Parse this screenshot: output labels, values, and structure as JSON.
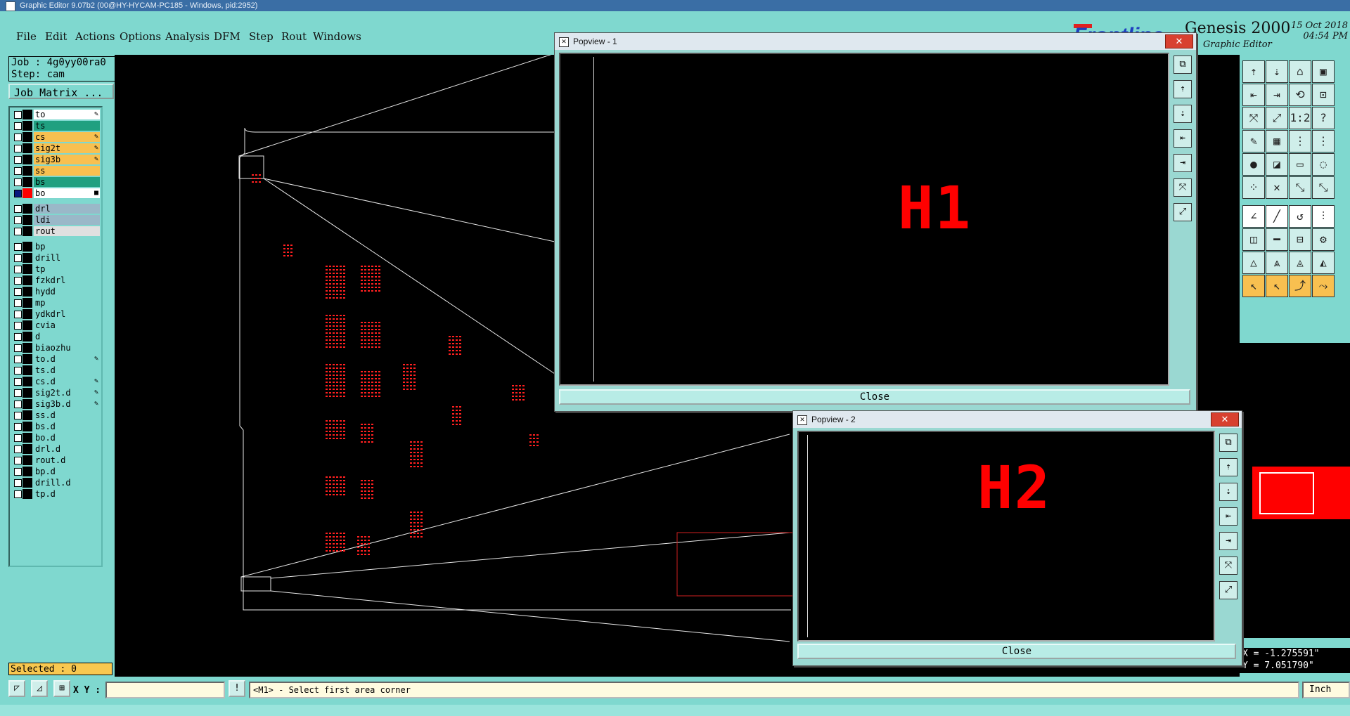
{
  "window": {
    "title": "Graphic Editor 9.07b2 (00@HY-HYCAM-PC185 - Windows, pid:2952)"
  },
  "menu": [
    "File",
    "Edit",
    "Actions",
    "Options",
    "Analysis",
    "DFM",
    "Step",
    "Rout",
    "Windows"
  ],
  "brand": {
    "logo": "Frontline",
    "product": "Genesis 2000",
    "subtitle": "Graphic Editor",
    "date": "15 Oct 2018",
    "time": "04:54 PM"
  },
  "job": {
    "job_label": "Job : 4g0yy00ra0",
    "step_label": "Step: cam",
    "matrix_button": "Job Matrix ..."
  },
  "layers": [
    {
      "name": "to",
      "color": "#ffffff",
      "mark": "✎"
    },
    {
      "name": "ts",
      "color": "#20a080",
      "mark": ""
    },
    {
      "name": "cs",
      "color": "#f8c050",
      "mark": "✎"
    },
    {
      "name": "sig2t",
      "color": "#f8c050",
      "mark": "✎"
    },
    {
      "name": "sig3b",
      "color": "#f8c050",
      "mark": "✎"
    },
    {
      "name": "ss",
      "color": "#f8c050",
      "mark": ""
    },
    {
      "name": "bs",
      "color": "#20a080",
      "mark": ""
    },
    {
      "name": "bo",
      "color": "#ffffff",
      "mark": "■",
      "active": true
    },
    {
      "name": "drl",
      "color": "#9ab8c8",
      "mark": ""
    },
    {
      "name": "ldi",
      "color": "#9ab8c8",
      "mark": ""
    },
    {
      "name": "rout",
      "color": "#e0e0e0",
      "mark": ""
    },
    {
      "name": "bp",
      "color": "#7fd8cf",
      "mark": ""
    },
    {
      "name": "drill",
      "color": "#7fd8cf",
      "mark": ""
    },
    {
      "name": "tp",
      "color": "#7fd8cf",
      "mark": ""
    },
    {
      "name": "fzkdrl",
      "color": "#7fd8cf",
      "mark": ""
    },
    {
      "name": "hydd",
      "color": "#7fd8cf",
      "mark": ""
    },
    {
      "name": "mp",
      "color": "#7fd8cf",
      "mark": ""
    },
    {
      "name": "ydkdrl",
      "color": "#7fd8cf",
      "mark": ""
    },
    {
      "name": "cvia",
      "color": "#7fd8cf",
      "mark": ""
    },
    {
      "name": "d",
      "color": "#7fd8cf",
      "mark": ""
    },
    {
      "name": "biaozhu",
      "color": "#7fd8cf",
      "mark": ""
    },
    {
      "name": "to.d",
      "color": "#7fd8cf",
      "mark": "✎"
    },
    {
      "name": "ts.d",
      "color": "#7fd8cf",
      "mark": ""
    },
    {
      "name": "cs.d",
      "color": "#7fd8cf",
      "mark": "✎"
    },
    {
      "name": "sig2t.d",
      "color": "#7fd8cf",
      "mark": "✎"
    },
    {
      "name": "sig3b.d",
      "color": "#7fd8cf",
      "mark": "✎"
    },
    {
      "name": "ss.d",
      "color": "#7fd8cf",
      "mark": ""
    },
    {
      "name": "bs.d",
      "color": "#7fd8cf",
      "mark": ""
    },
    {
      "name": "bo.d",
      "color": "#7fd8cf",
      "mark": ""
    },
    {
      "name": "drl.d",
      "color": "#7fd8cf",
      "mark": ""
    },
    {
      "name": "rout.d",
      "color": "#7fd8cf",
      "mark": ""
    },
    {
      "name": "bp.d",
      "color": "#7fd8cf",
      "mark": ""
    },
    {
      "name": "drill.d",
      "color": "#7fd8cf",
      "mark": ""
    },
    {
      "name": "tp.d",
      "color": "#7fd8cf",
      "mark": ""
    }
  ],
  "selected": "Selected : 0",
  "popview1": {
    "title": "Popview - 1",
    "label": "H1",
    "close": "Close"
  },
  "popview2": {
    "title": "Popview - 2",
    "label": "H2",
    "close": "Close"
  },
  "coords": {
    "x": "X = -1.275591\"",
    "y": "Y = 7.051790\""
  },
  "status": {
    "xy_label": "X Y :",
    "xy_value": "",
    "message": "<M1> - Select first area corner",
    "units": "Inch"
  }
}
